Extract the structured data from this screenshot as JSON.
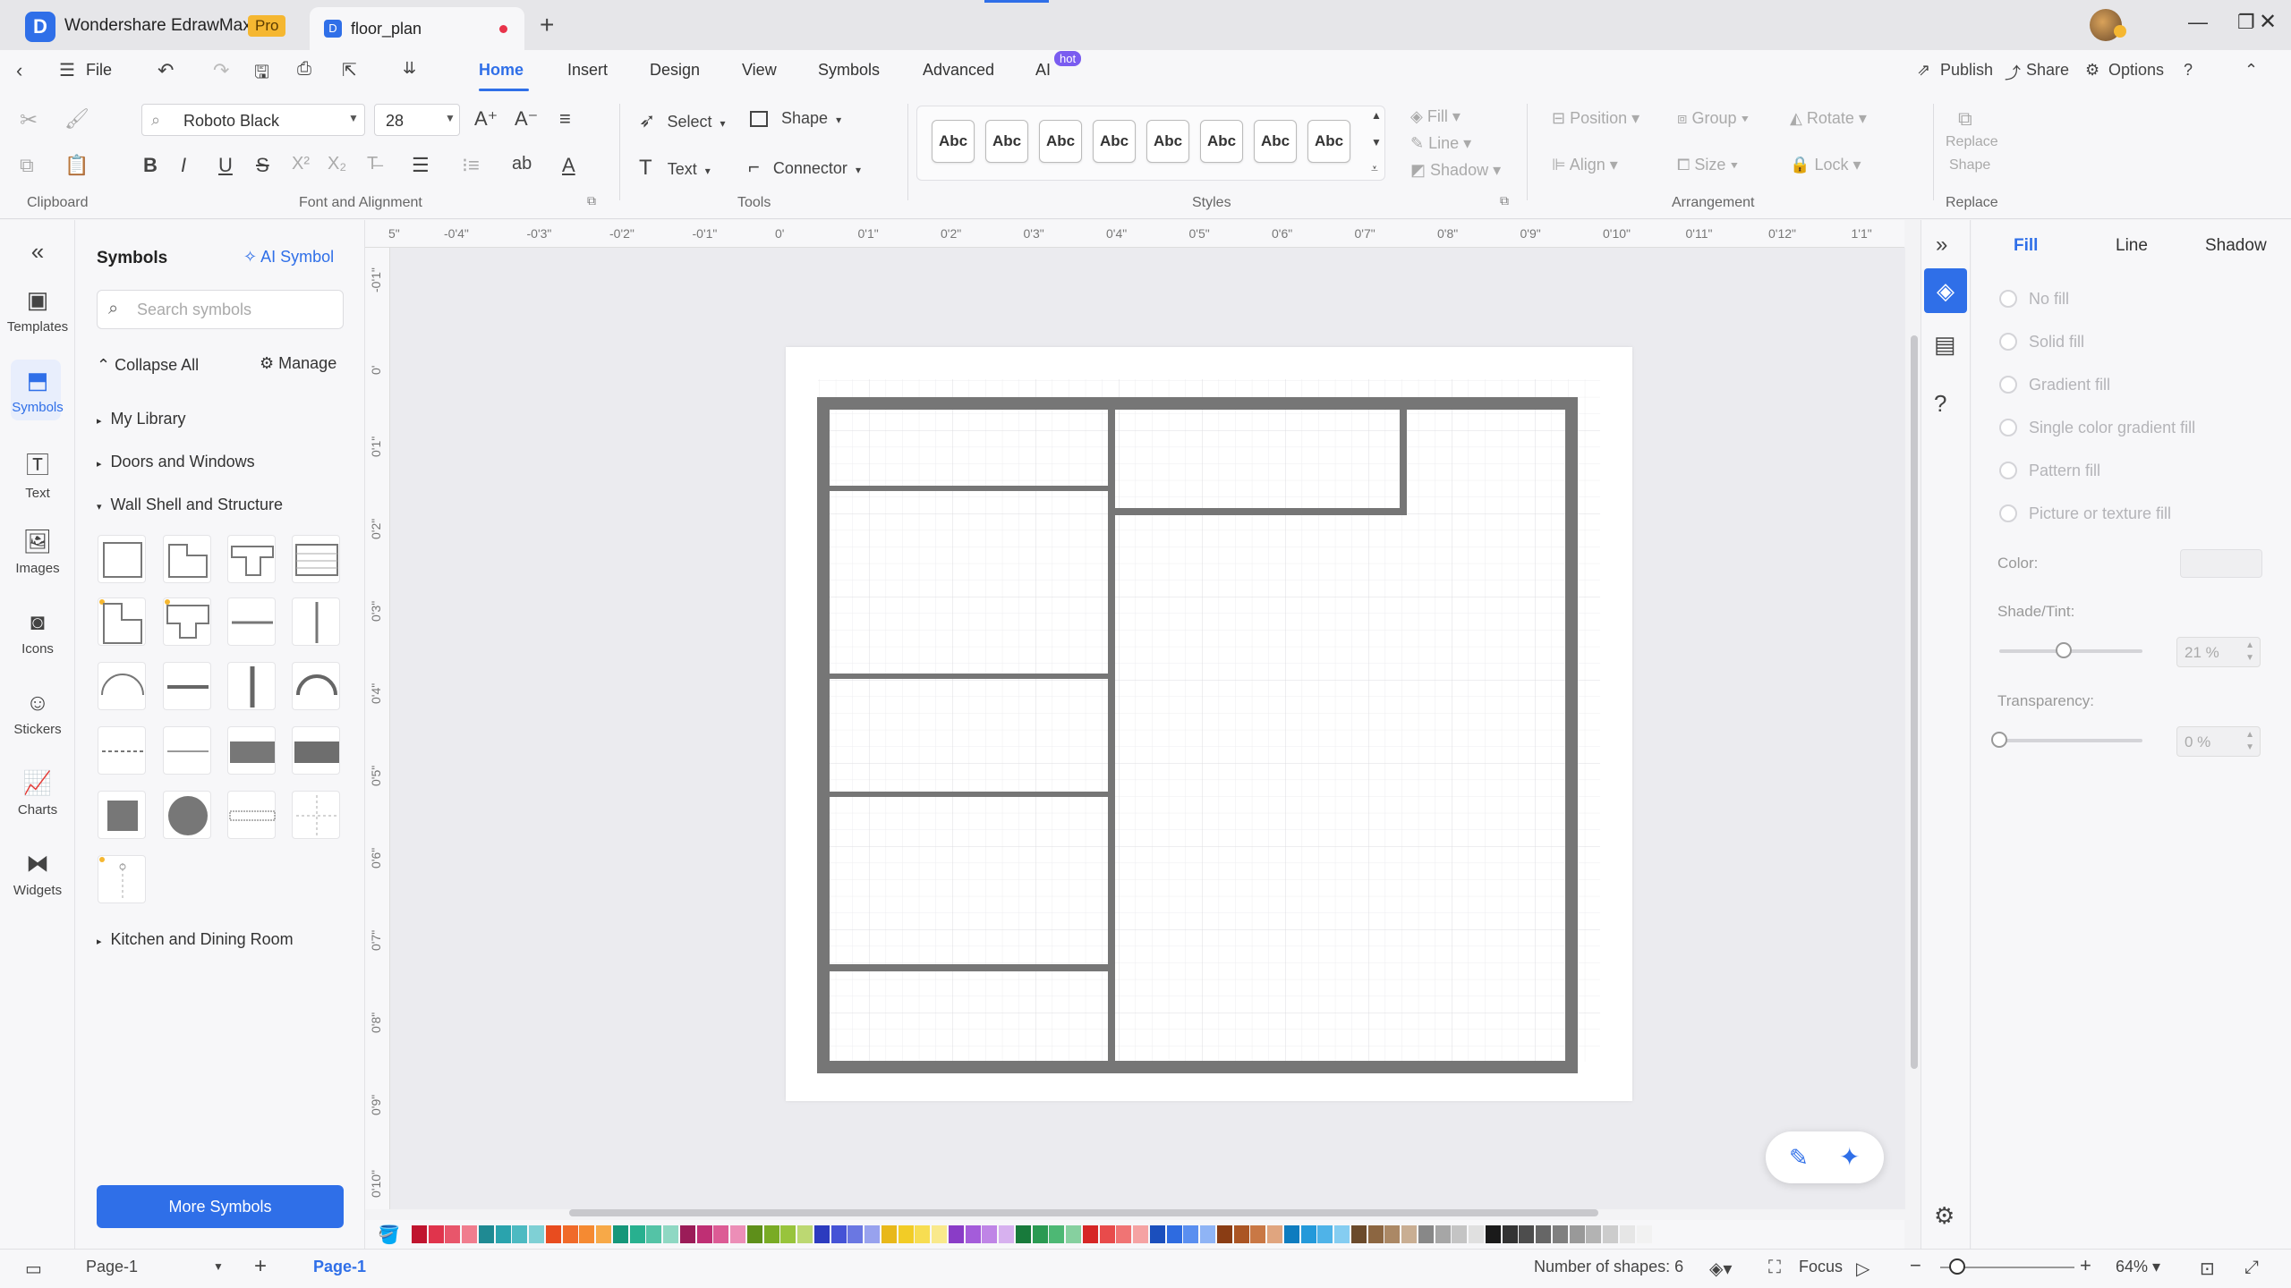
{
  "titlebar": {
    "app_name": "Wondershare EdrawMax",
    "pro_badge": "Pro",
    "doc_tab": "floor_plan",
    "new_tab": "+",
    "app_logo_letter": "D"
  },
  "menubar": {
    "file": "File",
    "tabs": [
      "Home",
      "Insert",
      "Design",
      "View",
      "Symbols",
      "Advanced",
      "AI"
    ],
    "hot_badge": "hot",
    "publish": "Publish",
    "share": "Share",
    "options": "Options"
  },
  "ribbon": {
    "font_name": "Roboto Black",
    "font_size": "28",
    "select": "Select",
    "shape": "Shape",
    "text": "Text",
    "connector": "Connector",
    "style_sample": "Abc",
    "fill": "Fill",
    "line": "Line",
    "shadow": "Shadow",
    "position": "Position",
    "group": "Group",
    "rotate": "Rotate",
    "align": "Align",
    "size": "Size",
    "lock": "Lock",
    "replace_shape_1": "Replace",
    "replace_shape_2": "Shape",
    "groups": {
      "clipboard": "Clipboard",
      "font_alignment": "Font and Alignment",
      "tools": "Tools",
      "styles": "Styles",
      "arrangement": "Arrangement",
      "replace": "Replace"
    }
  },
  "leftbar": {
    "items": [
      "Templates",
      "Symbols",
      "Text",
      "Images",
      "Icons",
      "Stickers",
      "Charts",
      "Widgets"
    ]
  },
  "symbols_panel": {
    "title": "Symbols",
    "ai_symbol": "AI Symbol",
    "search_placeholder": "Search symbols",
    "collapse_all": "Collapse All",
    "manage": "Manage",
    "my_library": "My Library",
    "doors_windows": "Doors and Windows",
    "wall_shell": "Wall Shell and Structure",
    "kitchen": "Kitchen and Dining Room",
    "more_symbols": "More Symbols"
  },
  "rulers": {
    "h": [
      "5\"",
      "-0'4\"",
      "-0'3\"",
      "-0'2\"",
      "-0'1\"",
      "0'",
      "0'1\"",
      "0'2\"",
      "0'3\"",
      "0'4\"",
      "0'5\"",
      "0'6\"",
      "0'7\"",
      "0'8\"",
      "0'9\"",
      "0'10\"",
      "0'11\"",
      "0'12\"",
      "1'1\""
    ],
    "v": [
      "-0'1\"",
      "0'",
      "0'1\"",
      "0'2\"",
      "0'3\"",
      "0'4\"",
      "0'5\"",
      "0'6\"",
      "0'7\"",
      "0'8\"",
      "0'9\"",
      "0'10\""
    ]
  },
  "fill_panel": {
    "tabs": [
      "Fill",
      "Line",
      "Shadow"
    ],
    "options": [
      "No fill",
      "Solid fill",
      "Gradient fill",
      "Single color gradient fill",
      "Pattern fill",
      "Picture or texture fill"
    ],
    "color_label": "Color:",
    "shade_label": "Shade/Tint:",
    "shade_value": "21 %",
    "shade_level": 0.45,
    "transparency_label": "Transparency:",
    "transparency_value": "0 %",
    "transparency_level": 0
  },
  "palette_colors": [
    "#c0152f",
    "#e0344c",
    "#e8566b",
    "#f07d8e",
    "#1f8a93",
    "#2aa3ad",
    "#4dbac2",
    "#7fd0d5",
    "#e84c1f",
    "#f06a2a",
    "#f58a32",
    "#f7a948",
    "#15977a",
    "#28b08f",
    "#54c3a6",
    "#8fd8c3",
    "#9b1c58",
    "#bf2f74",
    "#dc5b95",
    "#ec8eb7",
    "#5e8f1a",
    "#79ab25",
    "#98c43c",
    "#bcd872",
    "#2c3bbf",
    "#4553d6",
    "#6a77e2",
    "#98a2ee",
    "#e8b81a",
    "#f2cc26",
    "#f7dd52",
    "#f9e98c",
    "#8a3cc7",
    "#a45cda",
    "#bf85e6",
    "#d7b1ef",
    "#187a3b",
    "#2a9a52",
    "#4db874",
    "#86d09f",
    "#d62626",
    "#e84b4b",
    "#f07474",
    "#f5a3a3",
    "#1b4fbd",
    "#2e6be0",
    "#5a8ff0",
    "#8fb4f5",
    "#8a3d14",
    "#ab5524",
    "#c97845",
    "#e0a57f",
    "#0e7cbf",
    "#2399da",
    "#4fb3e8",
    "#85cdf1",
    "#6b4a2b",
    "#8c6641",
    "#ab8865",
    "#c9ae93",
    "#888888",
    "#a6a6a6",
    "#c4c4c4",
    "#e0e0e0",
    "#1a1a1a",
    "#333333",
    "#4d4d4d",
    "#666666",
    "#808080",
    "#999999",
    "#b3b3b3",
    "#cccccc",
    "#e6e6e6",
    "#f2f2f2"
  ],
  "statusbar": {
    "page_select": "Page-1",
    "page_tab": "Page-1",
    "add_page": "+",
    "shapes_count": "Number of shapes: 6",
    "focus": "Focus",
    "zoom": "64%"
  }
}
